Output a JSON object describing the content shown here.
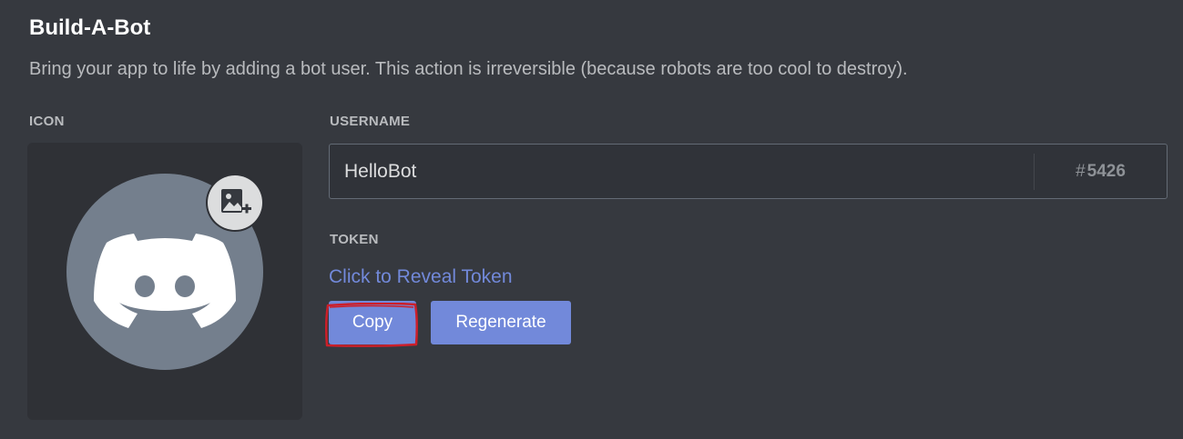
{
  "header": {
    "title": "Build-A-Bot",
    "subtitle": "Bring your app to life by adding a bot user. This action is irreversible (because robots are too cool to destroy)."
  },
  "icon_section": {
    "label": "ICON",
    "avatar_icon": "discord-logo-icon",
    "upload_icon": "image-add-icon"
  },
  "username_section": {
    "label": "USERNAME",
    "value": "HelloBot",
    "discriminator_hash": "#",
    "discriminator_number": "5426"
  },
  "token_section": {
    "label": "TOKEN",
    "reveal_link": "Click to Reveal Token",
    "copy_label": "Copy",
    "regenerate_label": "Regenerate"
  },
  "colors": {
    "background": "#36393f",
    "panel": "#2f3136",
    "accent": "#7289da",
    "avatar": "#747f8d",
    "annotation": "#cc1f2a"
  }
}
